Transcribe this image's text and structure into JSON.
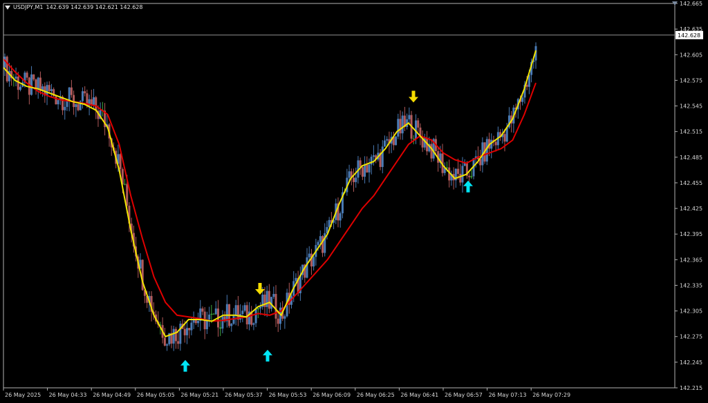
{
  "header": {
    "symbol": "USDJPY,M1",
    "ohlc": "142.639 142.639 142.621 142.628"
  },
  "colors": {
    "background": "#000000",
    "axis": "#b4b4b4",
    "bull_candle": "#4a7bb5",
    "bear_candle": "#b15a5a",
    "doji_candle": "#3fa83f",
    "fast_ma": "#f2e500",
    "slow_ma": "#e00000",
    "sell_arrow": "#f5dc00",
    "buy_arrow": "#00e5f5",
    "price_line": "#a7a7a7"
  },
  "chart_data": {
    "type": "candlestick",
    "symbol": "USDJPY",
    "timeframe": "M1",
    "current_price": 142.628,
    "ylim": [
      142.215,
      142.665
    ],
    "y_ticks": [
      "142.665",
      "142.635",
      "142.605",
      "142.575",
      "142.545",
      "142.515",
      "142.485",
      "142.455",
      "142.425",
      "142.395",
      "142.365",
      "142.335",
      "142.305",
      "142.275",
      "142.245",
      "142.215"
    ],
    "x_ticks": [
      "26 May 2025",
      "26 May 04:33",
      "26 May 04:49",
      "26 May 05:05",
      "26 May 05:21",
      "26 May 05:37",
      "26 May 05:53",
      "26 May 06:09",
      "26 May 06:25",
      "26 May 06:41",
      "26 May 06:57",
      "26 May 07:13",
      "26 May 07:29"
    ],
    "fast_ma": [
      142.59,
      142.575,
      142.568,
      142.565,
      142.56,
      142.555,
      142.55,
      142.547,
      142.54,
      142.52,
      142.47,
      142.4,
      142.34,
      142.3,
      142.275,
      142.28,
      142.295,
      142.295,
      142.293,
      142.3,
      142.3,
      142.298,
      142.31,
      142.315,
      142.3,
      142.33,
      142.355,
      142.375,
      142.395,
      142.43,
      142.46,
      142.475,
      142.48,
      142.495,
      142.515,
      142.525,
      142.51,
      142.495,
      142.475,
      142.46,
      142.465,
      142.48,
      142.5,
      142.51,
      142.53,
      142.565,
      142.61
    ],
    "slow_ma": [
      142.6,
      142.585,
      142.572,
      142.562,
      142.556,
      142.552,
      142.55,
      142.548,
      142.545,
      142.535,
      142.5,
      142.44,
      142.39,
      142.345,
      142.315,
      142.3,
      142.298,
      142.296,
      142.293,
      142.294,
      142.296,
      142.298,
      142.302,
      142.3,
      142.305,
      142.32,
      142.335,
      142.35,
      142.365,
      142.385,
      142.405,
      142.425,
      142.44,
      142.46,
      142.48,
      142.5,
      142.51,
      142.505,
      142.49,
      142.482,
      142.478,
      142.485,
      142.49,
      142.495,
      142.505,
      142.535,
      142.572
    ],
    "sell_signals": [
      142.32,
      142.545
    ],
    "buy_signals": [
      142.25,
      142.262,
      142.46
    ]
  }
}
